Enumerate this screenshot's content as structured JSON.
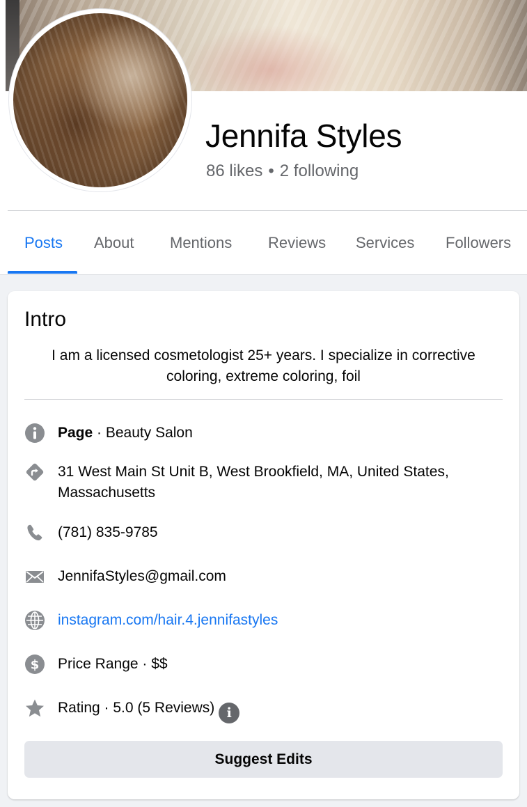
{
  "profile": {
    "name": "Jennifa Styles",
    "likes": "86 likes",
    "separator": "•",
    "following": "2 following"
  },
  "tabs": [
    {
      "label": "Posts",
      "active": true
    },
    {
      "label": "About"
    },
    {
      "label": "Mentions"
    },
    {
      "label": "Reviews"
    },
    {
      "label": "Services"
    },
    {
      "label": "Followers"
    }
  ],
  "intro": {
    "title": "Intro",
    "bio": "I am a licensed cosmetologist 25+ years. I specialize in corrective coloring, extreme coloring, foil",
    "category_label": "Page",
    "category_value": " · Beauty Salon",
    "address": "31 West Main St Unit B, West Brookfield, MA, United States, Massachusetts",
    "phone": "(781) 835-9785",
    "email": "JennifaStyles@gmail.com",
    "website": "instagram.com/hair.4.jennifastyles",
    "price_range": "Price Range · $$",
    "rating": "Rating · 5.0 (5 Reviews)",
    "info_glyph": "i",
    "suggest_button": "Suggest Edits"
  },
  "icons": {
    "category": "info-icon",
    "address": "directions-icon",
    "phone": "phone-icon",
    "email": "mail-icon",
    "website": "globe-icon",
    "price": "dollar-icon",
    "rating": "star-icon"
  },
  "colors": {
    "accent": "#1877f2",
    "secondary_text": "#65676b",
    "icon_gray": "#8a8d91",
    "background": "#f0f2f5",
    "button_bg": "#e4e6eb"
  }
}
